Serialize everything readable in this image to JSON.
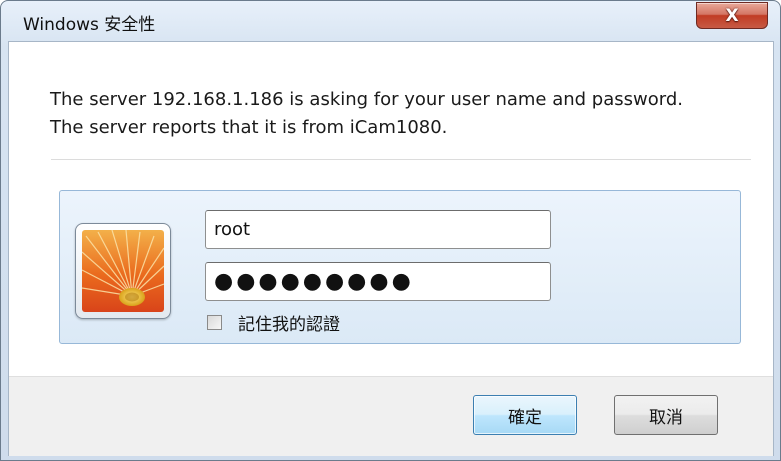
{
  "window": {
    "title": "Windows 安全性",
    "close_label": "X"
  },
  "message": {
    "line1": "The server 192.168.1.186 is asking for your user name and password.",
    "line2": "The server reports that it is from iCam1080."
  },
  "credentials": {
    "avatar_icon": "flower-user-icon",
    "username_value": "root",
    "password_mask": "●●●●●●●●●",
    "remember_checked": false,
    "remember_label": "記住我的認證"
  },
  "buttons": {
    "ok_label": "確定",
    "cancel_label": "取消"
  },
  "colors": {
    "close_button": "#c75a44",
    "ok_button_border": "#3c7fb1",
    "panel_border": "#97b8d8"
  }
}
